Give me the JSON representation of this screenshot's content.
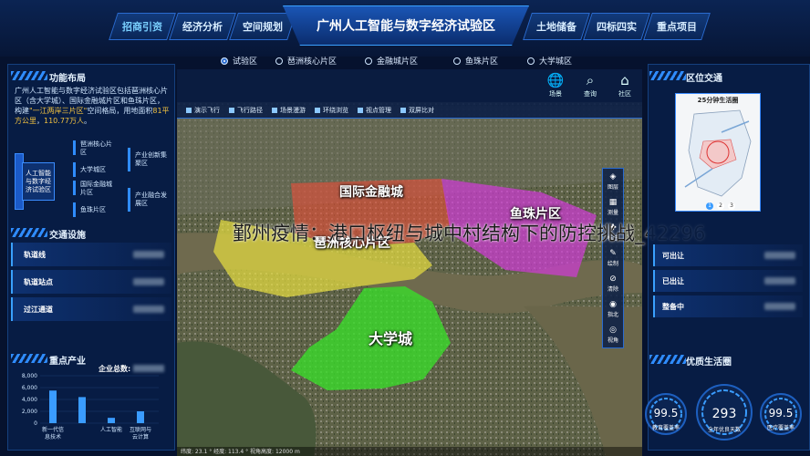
{
  "nav": {
    "title": "广州人工智能与数字经济试验区",
    "left": [
      "招商引资",
      "经济分析",
      "空间规划"
    ],
    "right": [
      "土地储备",
      "四标四实",
      "重点项目"
    ],
    "active": "招商引资"
  },
  "layout_panel": {
    "title": "功能布局",
    "desc_1": "广州人工智能与数字经济试验区包括琶洲核心片区（含大学城）、国际金融城片区和鱼珠片区，构建",
    "desc_highlight_1": "\"一江两岸三片区\"",
    "desc_2": "空间格局，用地面积",
    "desc_highlight_2": "81平方公里",
    "desc_3": "，",
    "desc_highlight_3": "110.77万人",
    "desc_4": "。",
    "root": "人工智能与数字经济试验区",
    "areas": [
      "琶洲核心片区",
      "大学城区",
      "国际金融城片区",
      "鱼珠片区"
    ],
    "features": [
      "产业创新集聚区",
      "产业融合发展区"
    ]
  },
  "traffic_panel": {
    "title": "交通设施",
    "rows": [
      "轨道线",
      "轨道站点",
      "过江通道"
    ]
  },
  "industry_panel": {
    "title": "重点产业",
    "total_label": "企业总数:",
    "y_ticks": [
      "8,000",
      "6,000",
      "4,000",
      "2,000",
      "0"
    ],
    "bars": [
      {
        "label": "新一代信息技术",
        "value": 5500
      },
      {
        "label": "",
        "value": 4400
      },
      {
        "label": "人工智能",
        "value": 900
      },
      {
        "label": "互联网与云计算",
        "value": 2000
      }
    ],
    "bar_color": "#3a9cff"
  },
  "map": {
    "tabs": [
      "试验区",
      "琶洲核心片区",
      "金融城片区",
      "鱼珠片区",
      "大学城区"
    ],
    "selected_tab": "试验区",
    "top_icons": [
      {
        "icon": "globe-icon",
        "label": "场景"
      },
      {
        "icon": "search-icon",
        "label": "查询"
      },
      {
        "icon": "home-icon",
        "label": "社区"
      }
    ],
    "tools": [
      "演示飞行",
      "飞行路径",
      "场景漫游",
      "环绕浏览",
      "视点管理",
      "双屏比对"
    ],
    "side_tools": [
      "图层",
      "测量",
      "标注",
      "绘制",
      "清除",
      "指北",
      "视角"
    ],
    "zones": [
      {
        "label": "国际金融城",
        "color": "#e0503a"
      },
      {
        "label": "鱼珠片区",
        "color": "#d23ad8"
      },
      {
        "label": "琶洲核心片区",
        "color": "#e8e040"
      },
      {
        "label": "大学城",
        "color": "#3adc2a"
      }
    ],
    "status": "纬度: 23.1 ° 经度: 113.4 ° 视角高度: 12000 m"
  },
  "watermark": "鄞州疫情：港口枢纽与城中村结构下的防控挑战_42296",
  "location_panel": {
    "title": "区位交通",
    "subtitle": "25分钟生活圈",
    "pages": [
      "1",
      "2",
      "3"
    ]
  },
  "status_panel": {
    "rows": [
      "可出让",
      "已出让",
      "整备中"
    ]
  },
  "quality_panel": {
    "title": "优质生活圈",
    "gauges": [
      {
        "value": "99.5",
        "label": "教育覆盖率"
      },
      {
        "value": "293",
        "label": "全年优良天数"
      },
      {
        "value": "99.5",
        "label": "医疗覆盖率"
      }
    ]
  }
}
